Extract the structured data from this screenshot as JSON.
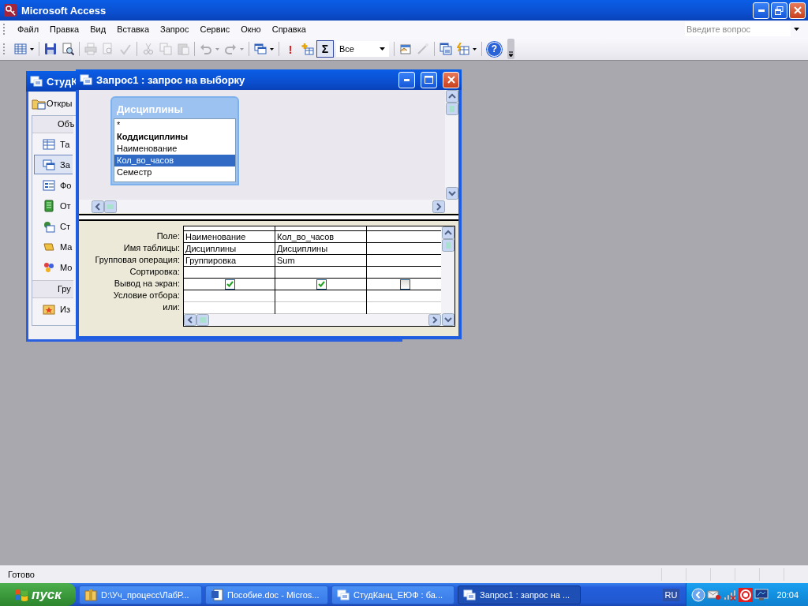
{
  "window": {
    "title": "Microsoft Access"
  },
  "menu": [
    {
      "label": "Файл"
    },
    {
      "label": "Правка"
    },
    {
      "label": "Вид"
    },
    {
      "label": "Вставка"
    },
    {
      "label": "Запрос"
    },
    {
      "label": "Сервис"
    },
    {
      "label": "Окно"
    },
    {
      "label": "Справка"
    }
  ],
  "help_box": {
    "placeholder": "Введите вопрос"
  },
  "toolbar": {
    "buttons": [
      {
        "disabled": false,
        "pressed": false
      },
      {
        "disabled": false,
        "pressed": false
      },
      {
        "disabled": false,
        "pressed": false
      },
      {
        "disabled": true,
        "pressed": false
      },
      {
        "disabled": true,
        "pressed": false
      },
      {
        "disabled": true,
        "pressed": false
      },
      {
        "disabled": true,
        "pressed": false
      },
      {
        "disabled": true,
        "pressed": false
      },
      {
        "disabled": true,
        "pressed": false
      },
      {
        "disabled": true,
        "pressed": false
      },
      {
        "disabled": true,
        "pressed": false
      },
      {
        "disabled": false,
        "pressed": false
      },
      {
        "disabled": false,
        "pressed": false,
        "label": "!"
      },
      {
        "disabled": false,
        "pressed": false
      },
      {
        "disabled": false,
        "pressed": true,
        "label": "Σ"
      },
      {
        "disabled": false,
        "pressed": false
      },
      {
        "disabled": true,
        "pressed": false
      },
      {
        "disabled": false,
        "pressed": false
      },
      {
        "disabled": false,
        "pressed": false
      },
      {
        "disabled": false,
        "pressed": false,
        "label": "?"
      }
    ],
    "combo": {
      "value": "Все"
    }
  },
  "database_window": {
    "title": "СтудК",
    "open_button": "Откры",
    "objects_header": "Объ",
    "objects": [
      {
        "label": "Та",
        "selected": false
      },
      {
        "label": "За",
        "selected": true
      },
      {
        "label": "Фо",
        "selected": false
      },
      {
        "label": "От",
        "selected": false
      },
      {
        "label": "Ст",
        "selected": false
      },
      {
        "label": "Ма",
        "selected": false
      },
      {
        "label": "Мо",
        "selected": false
      }
    ],
    "groups_header": "Гру",
    "groups": [
      {
        "label": "Из",
        "selected": false
      }
    ]
  },
  "query_window": {
    "title": "Запрос1 : запрос на выборку",
    "table": {
      "title": "Дисциплины",
      "fields": [
        {
          "label": "*",
          "primary_key": false,
          "selected": false
        },
        {
          "label": "Коддисциплины",
          "primary_key": true,
          "selected": false
        },
        {
          "label": "Наименование",
          "primary_key": false,
          "selected": false
        },
        {
          "label": "Кол_во_часов",
          "primary_key": false,
          "selected": true
        },
        {
          "label": "Семестр",
          "primary_key": false,
          "selected": false
        }
      ]
    },
    "grid": {
      "rows": [
        {
          "label": "Поле:",
          "kind": "field"
        },
        {
          "label": "Имя таблицы:",
          "kind": "table"
        },
        {
          "label": "Групповая операция:",
          "kind": "total"
        },
        {
          "label": "Сортировка:",
          "kind": "sort"
        },
        {
          "label": "Вывод на экран:",
          "kind": "show"
        },
        {
          "label": "Условие отбора:",
          "kind": "criteria"
        },
        {
          "label": "или:",
          "kind": "or"
        }
      ],
      "columns": [
        {
          "field": "Наименование",
          "table": "Дисциплины",
          "total": "Группировка",
          "show": true
        },
        {
          "field": "Кол_во_часов",
          "table": "Дисциплины",
          "total": "Sum",
          "show": true
        },
        {
          "show": false
        }
      ]
    }
  },
  "status_bar": {
    "text": "Готово"
  },
  "taskbar": {
    "start": "пуск",
    "tasks": [
      {
        "label": "D:\\Уч_процесс\\ЛабР...",
        "selected": false
      },
      {
        "label": "Пособие.doc - Micros...",
        "selected": false
      },
      {
        "label": "СтудКанц_ЕЮФ : ба...",
        "selected": false
      },
      {
        "label": "Запрос1 : запрос на ...",
        "selected": true
      }
    ],
    "language": "RU",
    "clock": "20:04"
  }
}
